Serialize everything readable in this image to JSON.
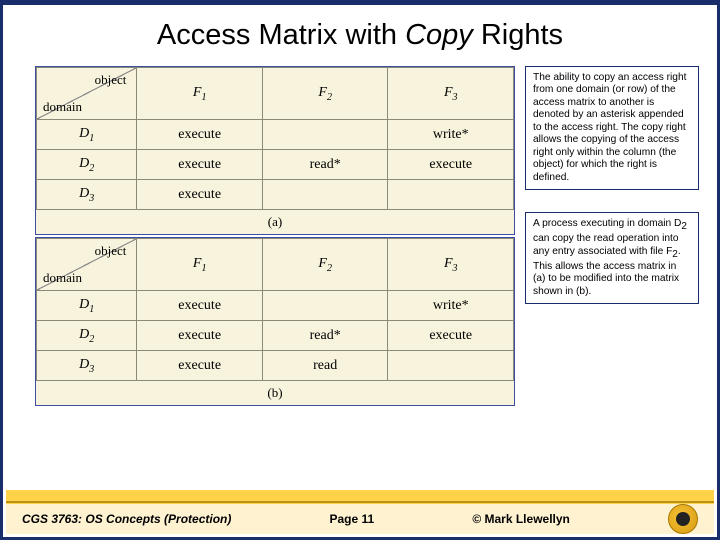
{
  "title_pre": "Access Matrix with ",
  "title_em": "Copy",
  "title_post": " Rights",
  "matrix_header": {
    "object": "object",
    "domain": "domain"
  },
  "cols": {
    "F": "F"
  },
  "rows": {
    "D": "D"
  },
  "tables": {
    "a": {
      "caption": "(a)",
      "cells": {
        "d1f1": "execute",
        "d1f2": "",
        "d1f3": "write*",
        "d2f1": "execute",
        "d2f2": "read*",
        "d2f3": "execute",
        "d3f1": "execute",
        "d3f2": "",
        "d3f3": ""
      }
    },
    "b": {
      "caption": "(b)",
      "cells": {
        "d1f1": "execute",
        "d1f2": "",
        "d1f3": "write*",
        "d2f1": "execute",
        "d2f2": "read*",
        "d2f3": "execute",
        "d3f1": "execute",
        "d3f2": "read",
        "d3f3": ""
      }
    }
  },
  "panel1": "The ability to copy an access right from one domain (or row) of the access matrix to another is denoted by an asterisk appended to the access right. The copy right allows the copying of the access right only within the column (the object) for which the right is defined.",
  "panel2_pre": "A process executing in domain D",
  "panel2_mid": " can copy the read operation into any entry associated with file F",
  "panel2_post": ". This allows the access matrix in (a) to be modified into the matrix shown in (b).",
  "footer": {
    "course": "CGS 3763: OS Concepts  (Protection)",
    "page": "Page 11",
    "author": "© Mark Llewellyn"
  }
}
